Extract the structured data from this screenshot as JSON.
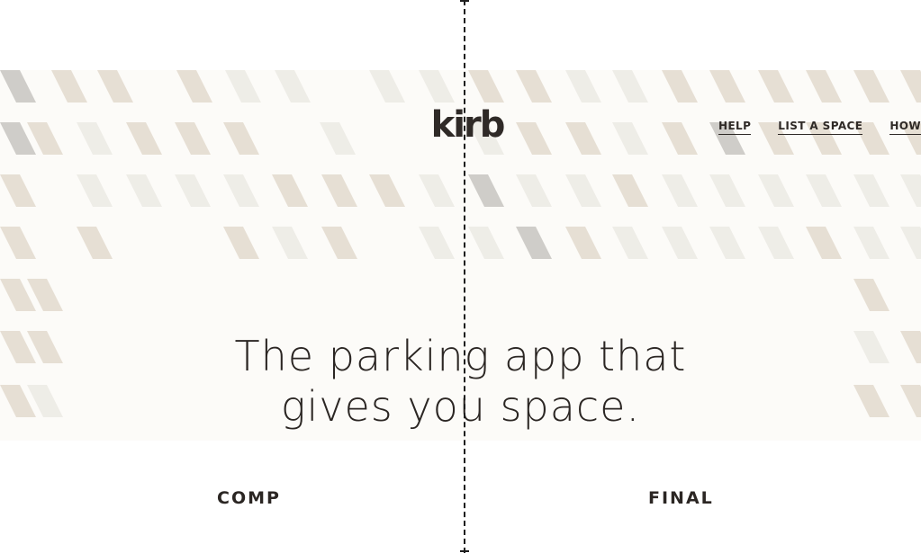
{
  "header": {
    "logo_text": "kirb",
    "nav": [
      {
        "label": "HELP"
      },
      {
        "label": "LIST A SPACE"
      },
      {
        "label": "HOW"
      }
    ]
  },
  "hero": {
    "headline_line1": "The parking app that",
    "headline_line2": "gives you space."
  },
  "labels": {
    "left": "COMP",
    "right": "FINAL"
  },
  "colors": {
    "hero_bg": "#fcfbf8",
    "stripe_beige": "#e6dfd4",
    "stripe_light": "#eeede7",
    "stripe_gray": "#cfcdc9",
    "text_dark": "#2b2623"
  }
}
